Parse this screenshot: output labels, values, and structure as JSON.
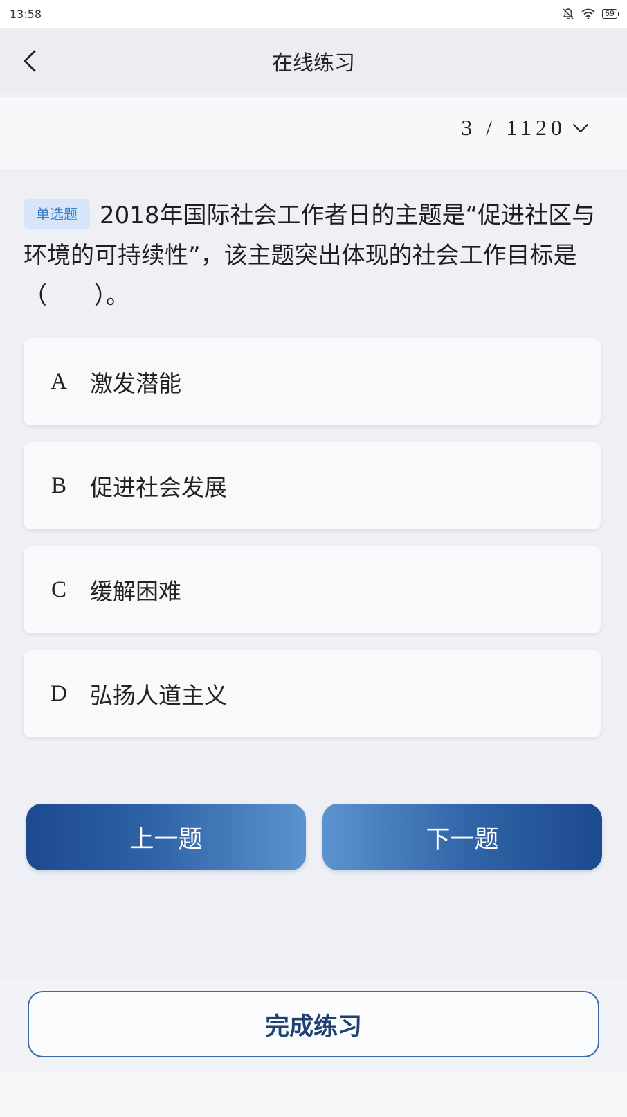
{
  "status_bar": {
    "time": "13:58",
    "battery": "69"
  },
  "header": {
    "title": "在线练习"
  },
  "progress": {
    "current": 3,
    "total": 1120,
    "text": "3 / 1120"
  },
  "question": {
    "type_badge": "单选题",
    "text": "2018年国际社会工作者日的主题是“促进社区与环境的可持续性”，该主题突出体现的社会工作目标是（　　）。"
  },
  "options": [
    {
      "letter": "A",
      "text": "激发潜能"
    },
    {
      "letter": "B",
      "text": "促进社会发展"
    },
    {
      "letter": "C",
      "text": "缓解困难"
    },
    {
      "letter": "D",
      "text": "弘扬人道主义"
    }
  ],
  "buttons": {
    "prev": "上一题",
    "next": "下一题",
    "finish": "完成练习"
  },
  "colors": {
    "primary": "#1d4a8e",
    "primary_light": "#5b93cf",
    "badge_bg": "#d6e6f8",
    "badge_text": "#3e7fc9"
  }
}
